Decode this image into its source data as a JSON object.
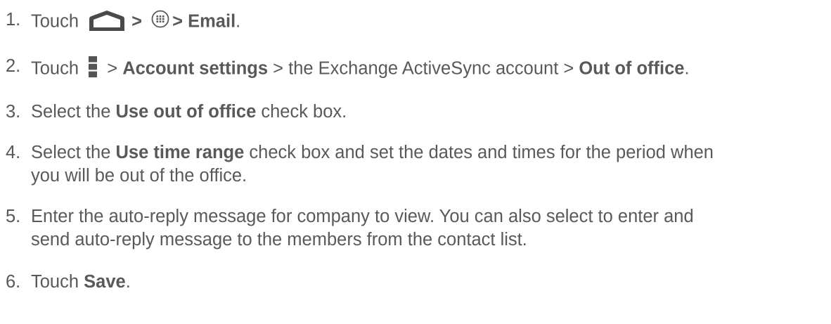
{
  "steps": [
    {
      "number": "1.",
      "text_a": "Touch",
      "sep_1": ">",
      "sep_2": "> Email",
      "end": ".",
      "icons": [
        "home-icon",
        "apps-icon"
      ]
    },
    {
      "number": "2.",
      "text_a": "Touch",
      "text_b": " > ",
      "bold_1": "Account settings",
      "text_c": " > the Exchange ActiveSync account > ",
      "bold_2": "Out of office",
      "end": ".",
      "icons": [
        "menu-icon"
      ]
    },
    {
      "number": "3.",
      "text_a": "Select the ",
      "bold_1": "Use out of office",
      "text_b": " check box."
    },
    {
      "number": "4.",
      "text_a": "Select the ",
      "bold_1": "Use time range",
      "text_b": " check box and set the dates and times for the period when",
      "line_2": "you will be out of the office."
    },
    {
      "number": "5.",
      "line_1": "Enter the auto-reply message for company to view. You can also select to enter and",
      "line_2": "send auto-reply message to the members from the contact list."
    },
    {
      "number": "6.",
      "text_a": "Touch ",
      "bold_1": "Save",
      "end": "."
    }
  ]
}
